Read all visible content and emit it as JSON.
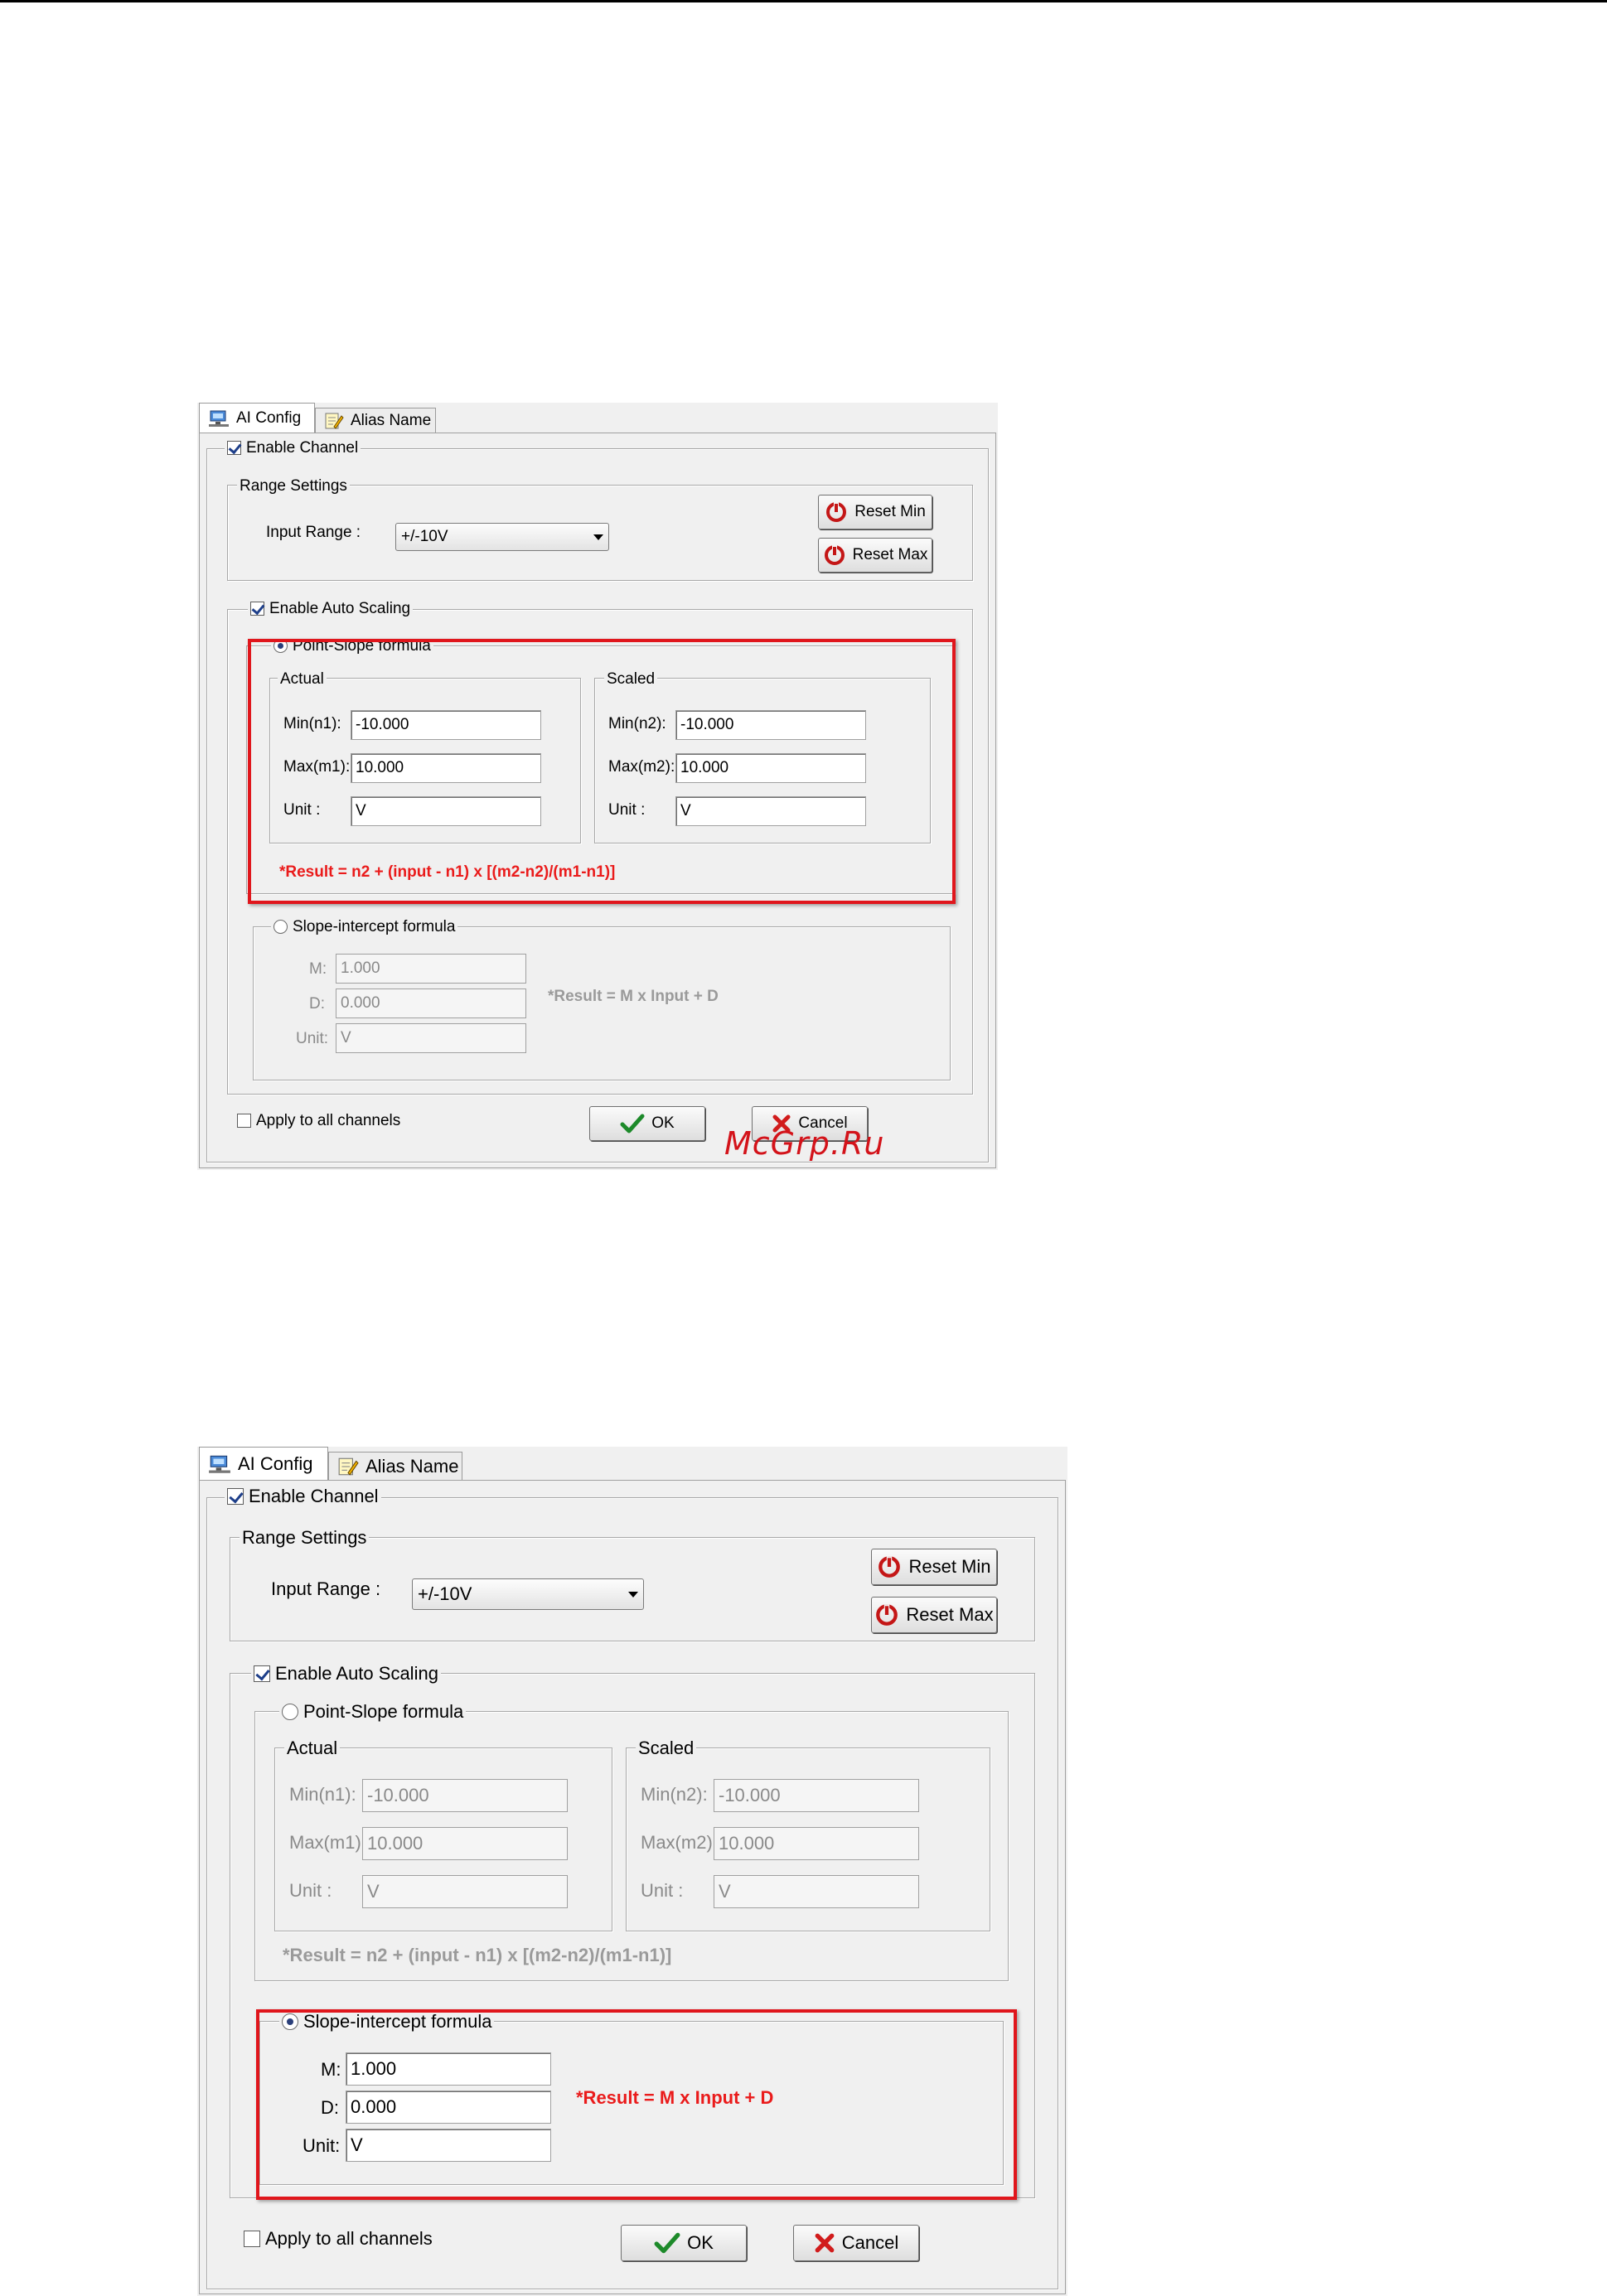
{
  "tabs": {
    "ai_config": "AI Config",
    "alias_name": "Alias Name"
  },
  "enable_channel": "Enable Channel",
  "range_settings": {
    "legend": "Range Settings",
    "input_range_label": "Input Range :",
    "input_range_value": "+/-10V",
    "reset_min": "Reset Min",
    "reset_max": "Reset Max"
  },
  "auto_scaling": "Enable Auto Scaling",
  "point_slope": {
    "legend": "Point-Slope formula",
    "actual": {
      "legend": "Actual",
      "min_label": "Min(n1):",
      "min_value": "-10.000",
      "max_label": "Max(m1):",
      "max_value": "10.000",
      "unit_label": "Unit :",
      "unit_value": "V"
    },
    "scaled": {
      "legend": "Scaled",
      "min_label": "Min(n2):",
      "min_value": "-10.000",
      "max_label": "Max(m2):",
      "max_value": "10.000",
      "unit_label": "Unit :",
      "unit_value": "V"
    },
    "formula": "*Result = n2 + (input - n1) x [(m2-n2)/(m1-n1)]"
  },
  "slope_intercept": {
    "legend": "Slope-intercept formula",
    "m_label": "M:",
    "m_value": "1.000",
    "d_label": "D:",
    "d_value": "0.000",
    "unit_label": "Unit:",
    "unit_value": "V",
    "formula": "*Result = M x Input + D"
  },
  "apply_all": "Apply to all channels",
  "ok": "OK",
  "cancel": "Cancel",
  "watermark": "McGrp.Ru",
  "colors": {
    "highlight": "#e0161c",
    "formula_red": "#ea1b1b",
    "dialog_bg": "#f0f0f0"
  }
}
